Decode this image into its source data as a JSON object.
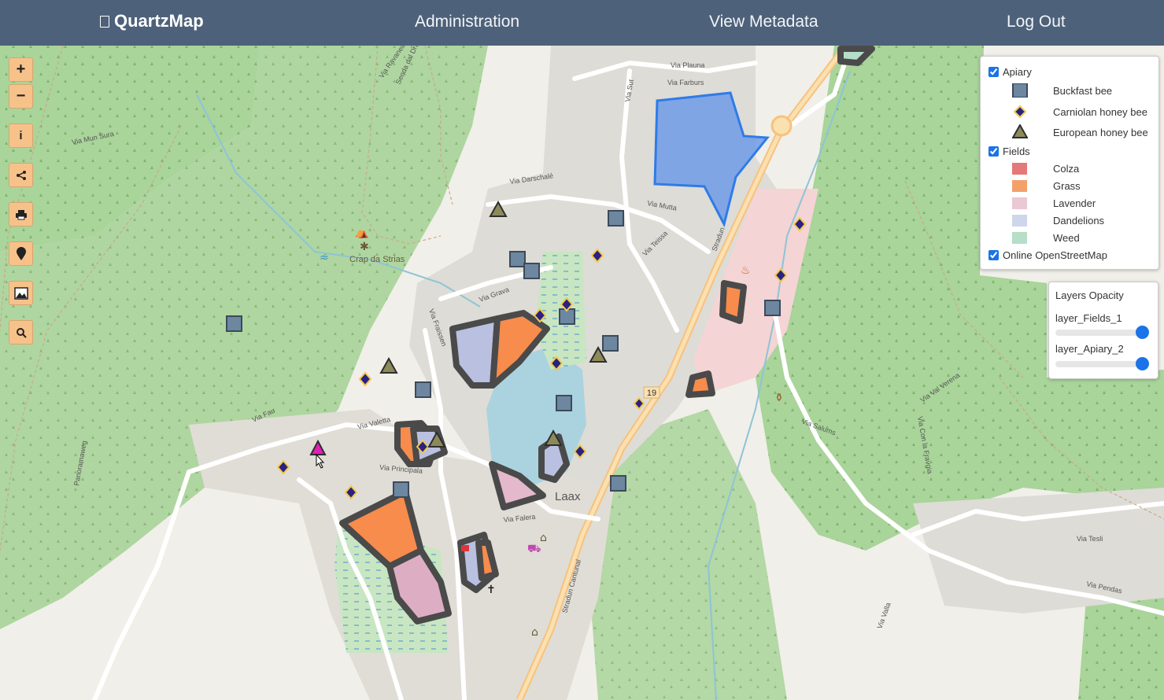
{
  "header": {
    "brand": "QuartzMap",
    "nav": [
      "Administration",
      "View Metadata",
      "Log Out"
    ]
  },
  "toolbar": {
    "buttons": [
      {
        "name": "zoom-in-button",
        "icon": "plus-icon",
        "glyph": "+"
      },
      {
        "name": "zoom-out-button",
        "icon": "minus-icon",
        "glyph": "−"
      },
      {
        "name": "info-button",
        "icon": "info-icon",
        "glyph": "i"
      },
      {
        "name": "share-button",
        "icon": "share-icon",
        "glyph": "⋖"
      },
      {
        "name": "print-button",
        "icon": "printer-icon",
        "glyph": "▤"
      },
      {
        "name": "locate-button",
        "icon": "map-pin-icon",
        "glyph": "●"
      },
      {
        "name": "layers-button",
        "icon": "image-icon",
        "glyph": "▨"
      },
      {
        "name": "search-button",
        "icon": "search-icon",
        "glyph": "⚲"
      }
    ]
  },
  "legend": {
    "groups": [
      {
        "label": "Apiary",
        "checked": true,
        "items": [
          "Buckfast bee",
          "Carniolan honey bee",
          "European honey bee"
        ]
      },
      {
        "label": "Fields",
        "checked": true,
        "items": [
          "Colza",
          "Grass",
          "Lavender",
          "Dandelions",
          "Weed"
        ]
      },
      {
        "label": "Online OpenStreetMap",
        "checked": true,
        "items": []
      }
    ],
    "colors": {
      "Colza": "#e06060",
      "Grass": "#f4a06a",
      "Lavender": "#eac8d4",
      "Dandelions": "#cdd6ea",
      "Weed": "#b6dec9"
    }
  },
  "opacity": {
    "title": "Layers Opacity",
    "layers": [
      {
        "label": "layer_Fields_1",
        "value": 1.0
      },
      {
        "label": "layer_Apiary_2",
        "value": 1.0
      }
    ]
  },
  "map": {
    "place_labels": [
      "Laax",
      "Crap da Strias",
      "19"
    ],
    "street_labels": [
      "Via Plauna",
      "Via Farburs",
      "Via Sut",
      "Via Darschalé",
      "Via Mutta",
      "Via Teissa",
      "Via Grava",
      "Via Fraissen",
      "Via Fau",
      "Via Valetta",
      "Via Falera",
      "Via Principala",
      "Stradun",
      "Stradun Cantunal",
      "Via Salums",
      "Via Val Verena",
      "Via Con la Fravgia",
      "Via Valla",
      "Via Pendas",
      "Via Tesli",
      "Via Mun Sura",
      "Panoramaweg",
      "Via Ravaneins",
      "Senda dal Dragun"
    ]
  }
}
